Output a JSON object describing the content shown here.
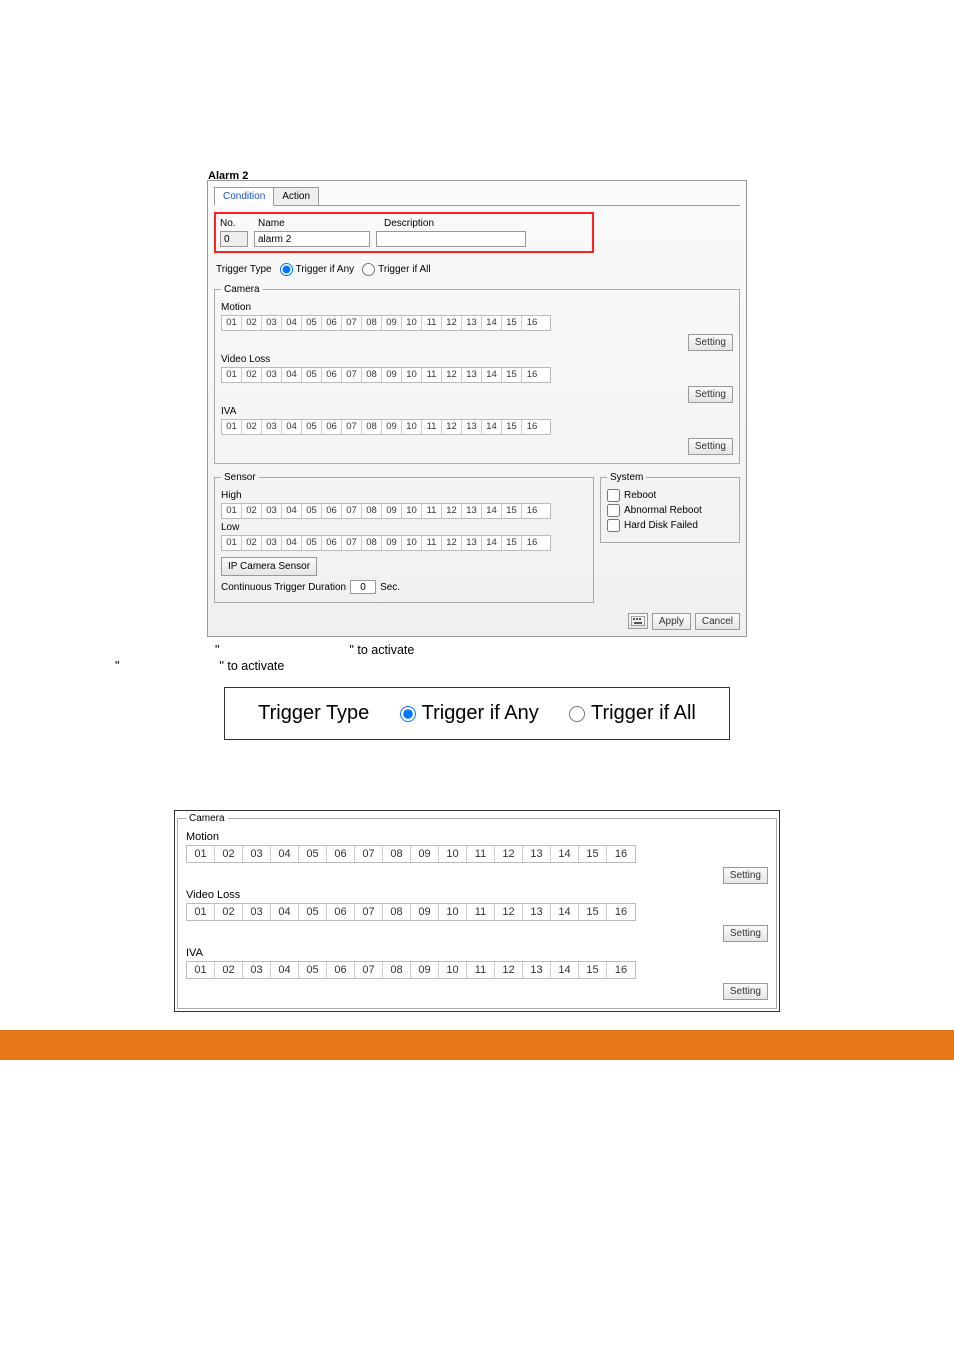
{
  "dialog": {
    "title": "Alarm 2",
    "tabs": {
      "condition": "Condition",
      "action": "Action"
    },
    "header": {
      "labels": {
        "no": "No.",
        "name": "Name",
        "desc": "Description"
      },
      "no_value": "0",
      "name_value": "alarm 2",
      "desc_value": ""
    },
    "trigger": {
      "label": "Trigger Type",
      "any": "Trigger if Any",
      "all": "Trigger if All"
    },
    "camera": {
      "legend": "Camera",
      "motion": "Motion",
      "videoloss": "Video Loss",
      "iva": "IVA",
      "setting": "Setting"
    },
    "sensor": {
      "legend": "Sensor",
      "high": "High",
      "low": "Low",
      "ip_sensor": "IP Camera Sensor",
      "duration_label": "Continuous Trigger Duration",
      "duration_value": "0",
      "duration_unit": "Sec."
    },
    "system": {
      "legend": "System",
      "reboot": "Reboot",
      "abnormal": "Abnormal Reboot",
      "hdd": "Hard Disk Failed"
    },
    "buttons": {
      "apply": "Apply",
      "cancel": "Cancel"
    }
  },
  "channels": [
    "01",
    "02",
    "03",
    "04",
    "05",
    "06",
    "07",
    "08",
    "09",
    "10",
    "11",
    "12",
    "13",
    "14",
    "15",
    "16"
  ],
  "instructions": {
    "line1_prefix": "\"",
    "line1_suffix": "\" to activate",
    "line2_prefix": "\"",
    "line2_suffix": "\" to activate"
  },
  "embed_trigger": {
    "label": "Trigger Type",
    "any": "Trigger if Any",
    "all": "Trigger if All"
  },
  "embed_camera": {
    "legend": "Camera",
    "motion": "Motion",
    "videoloss": "Video Loss",
    "iva": "IVA",
    "setting": "Setting"
  }
}
